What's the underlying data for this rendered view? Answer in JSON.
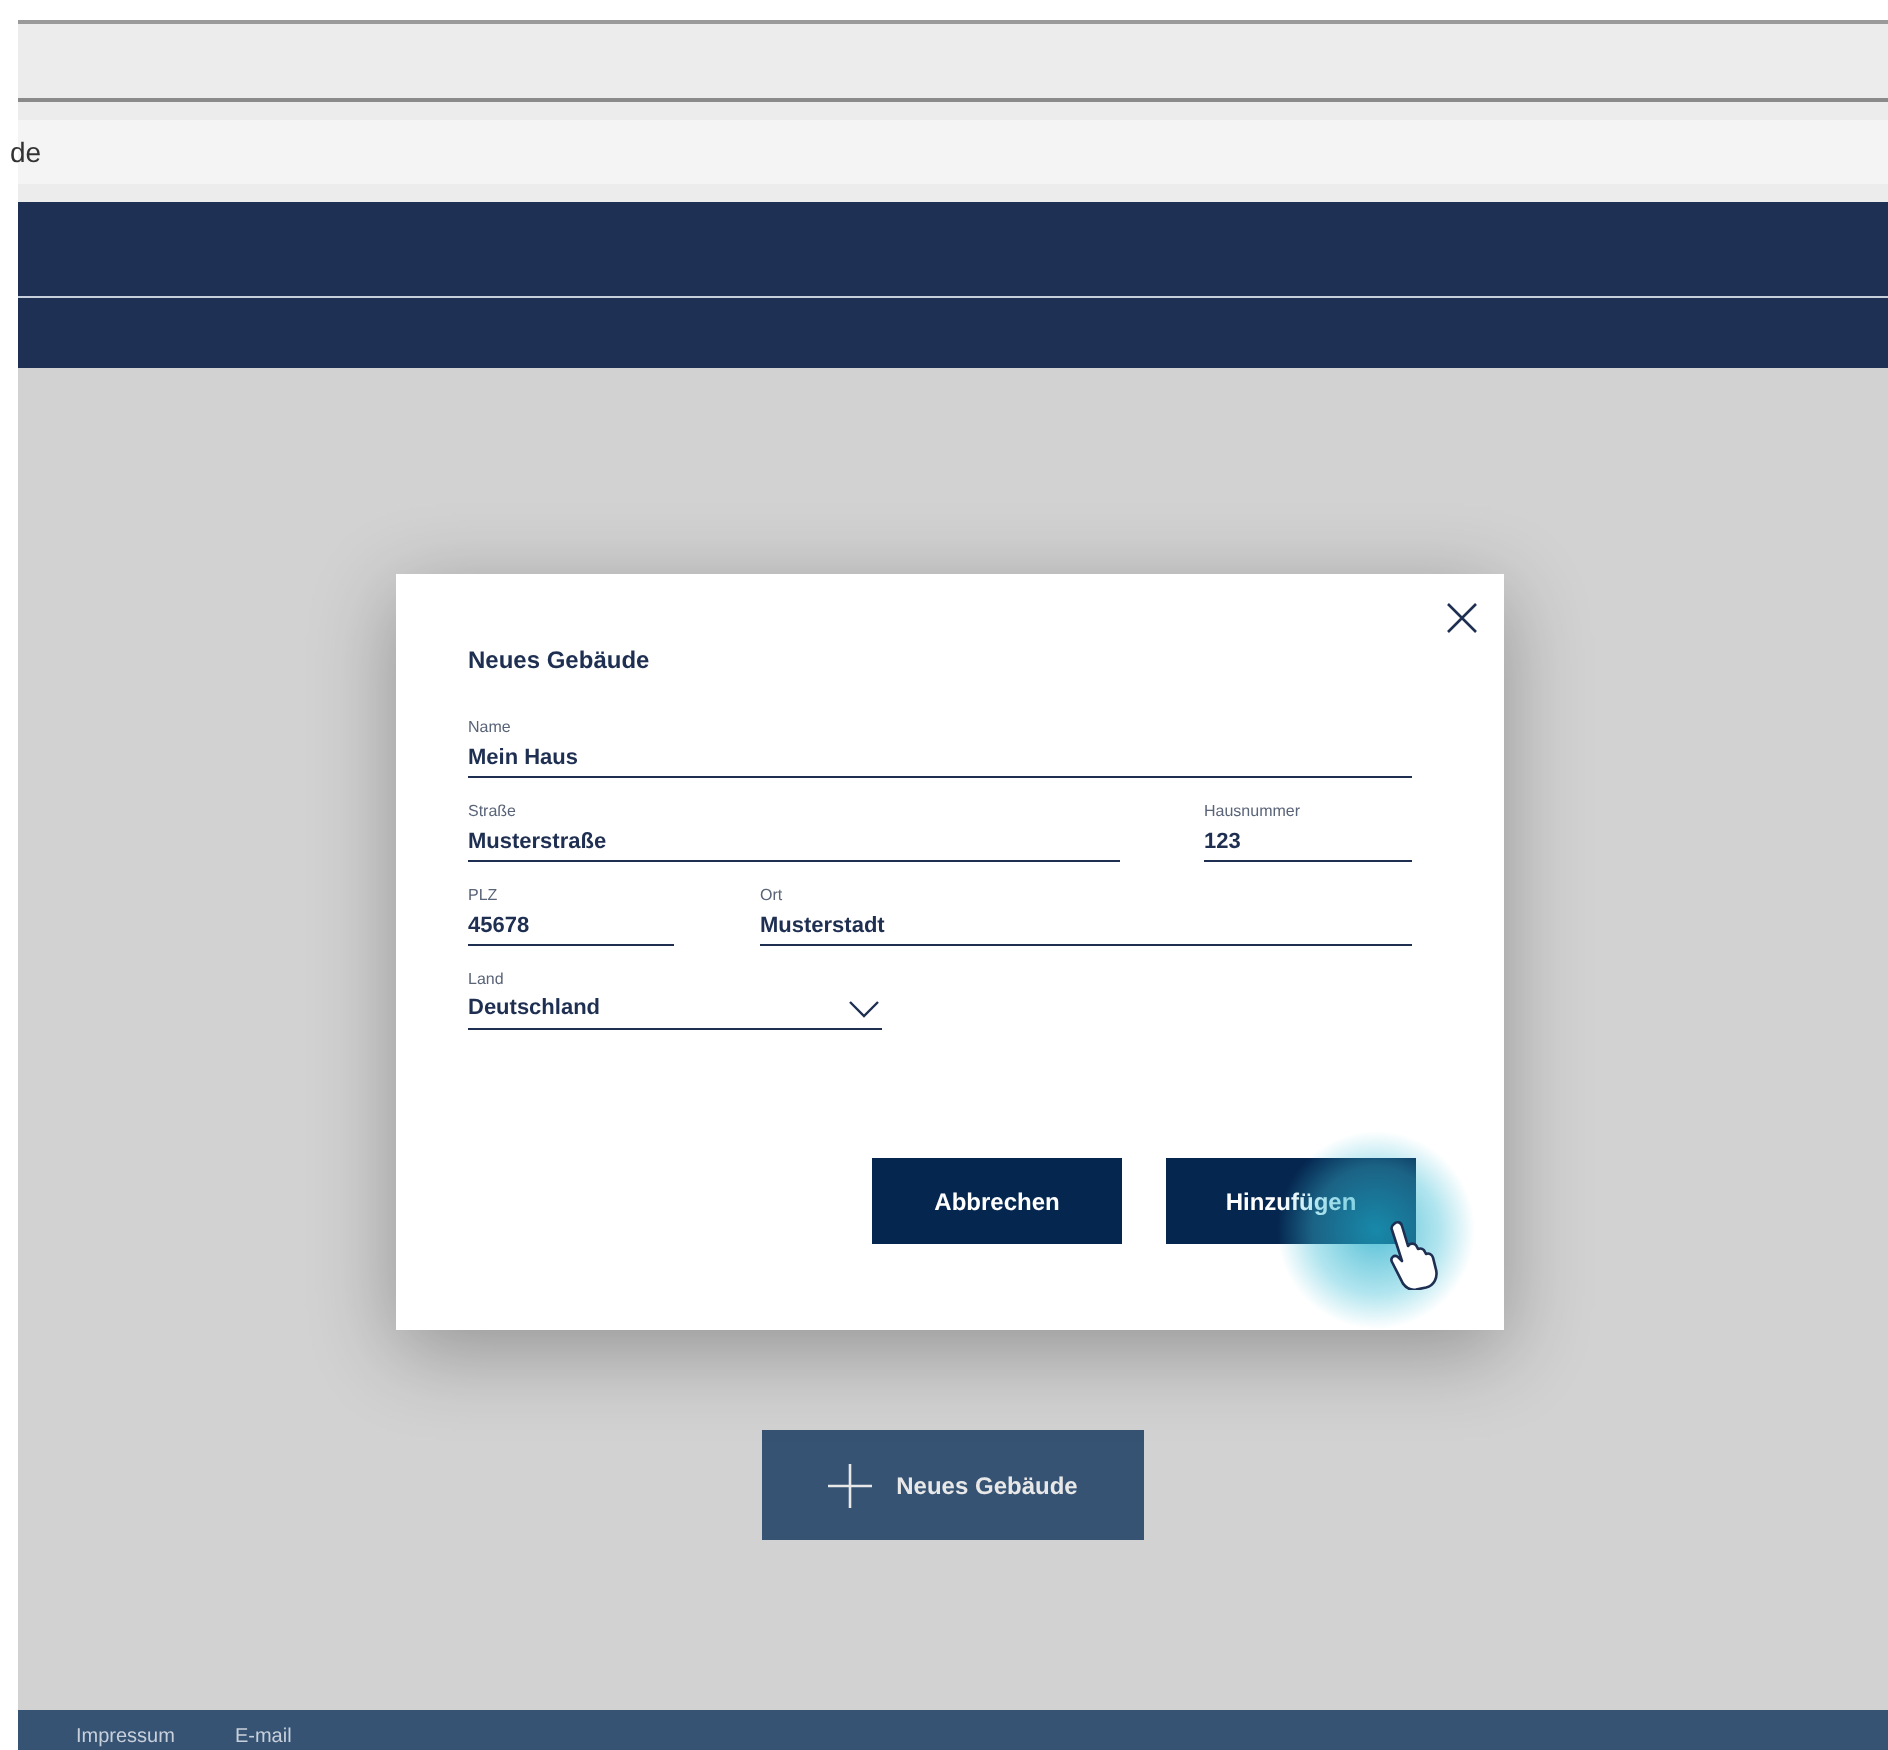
{
  "address_bar": {
    "text": "de"
  },
  "dialog": {
    "title": "Neues Gebäude",
    "fields": [
      {
        "label": "Name",
        "value": "Mein Haus",
        "kind": "text"
      },
      {
        "label": "Straße",
        "value": "Musterstraße",
        "kind": "text"
      },
      {
        "label": "Hausnummer",
        "value": "123",
        "kind": "text"
      },
      {
        "label": "PLZ",
        "value": "45678",
        "kind": "text"
      },
      {
        "label": "Ort",
        "value": "Musterstadt",
        "kind": "text"
      },
      {
        "label": "Land",
        "value": "Deutschland",
        "kind": "select"
      }
    ],
    "buttons": [
      "Abbrechen",
      "Hinzufügen"
    ]
  },
  "add_button": "Neues Gebäude",
  "footer_links": [
    "Impressum",
    "E-mail"
  ]
}
